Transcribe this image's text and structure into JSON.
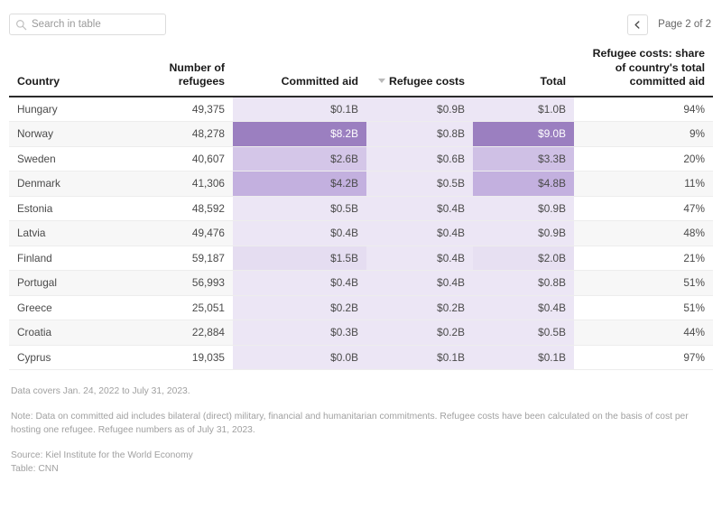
{
  "search": {
    "placeholder": "Search in table",
    "value": "",
    "icon": "search-icon"
  },
  "pagination": {
    "prev_icon": "chevron-left-icon",
    "label": "Page 2 of 2",
    "current_page": 2,
    "total_pages": 2
  },
  "table": {
    "sort": {
      "column": "Refugee costs",
      "direction": "descending",
      "indicator_icon": "triangle-down-icon"
    },
    "columns": [
      {
        "label": "Country",
        "align": "left"
      },
      {
        "label": "Number of refugees",
        "align": "right"
      },
      {
        "label": "Committed aid",
        "align": "right"
      },
      {
        "label": "Refugee costs",
        "align": "right"
      },
      {
        "label": "Total",
        "align": "right"
      },
      {
        "label": "Refugee costs: share of country's total committed aid",
        "align": "right"
      }
    ],
    "rows": [
      {
        "country": "Hungary",
        "refugees": "49,375",
        "committed_aid": "$0.1B",
        "refugee_costs": "$0.9B",
        "total": "$1.0B",
        "share": "94%"
      },
      {
        "country": "Norway",
        "refugees": "48,278",
        "committed_aid": "$8.2B",
        "refugee_costs": "$0.8B",
        "total": "$9.0B",
        "share": "9%"
      },
      {
        "country": "Sweden",
        "refugees": "40,607",
        "committed_aid": "$2.6B",
        "refugee_costs": "$0.6B",
        "total": "$3.3B",
        "share": "20%"
      },
      {
        "country": "Denmark",
        "refugees": "41,306",
        "committed_aid": "$4.2B",
        "refugee_costs": "$0.5B",
        "total": "$4.8B",
        "share": "11%"
      },
      {
        "country": "Estonia",
        "refugees": "48,592",
        "committed_aid": "$0.5B",
        "refugee_costs": "$0.4B",
        "total": "$0.9B",
        "share": "47%"
      },
      {
        "country": "Latvia",
        "refugees": "49,476",
        "committed_aid": "$0.4B",
        "refugee_costs": "$0.4B",
        "total": "$0.9B",
        "share": "48%"
      },
      {
        "country": "Finland",
        "refugees": "59,187",
        "committed_aid": "$1.5B",
        "refugee_costs": "$0.4B",
        "total": "$2.0B",
        "share": "21%"
      },
      {
        "country": "Portugal",
        "refugees": "56,993",
        "committed_aid": "$0.4B",
        "refugee_costs": "$0.4B",
        "total": "$0.8B",
        "share": "51%"
      },
      {
        "country": "Greece",
        "refugees": "25,051",
        "committed_aid": "$0.2B",
        "refugee_costs": "$0.2B",
        "total": "$0.4B",
        "share": "51%"
      },
      {
        "country": "Croatia",
        "refugees": "22,884",
        "committed_aid": "$0.3B",
        "refugee_costs": "$0.2B",
        "total": "$0.5B",
        "share": "44%"
      },
      {
        "country": "Cyprus",
        "refugees": "19,035",
        "committed_aid": "$0.0B",
        "refugee_costs": "$0.1B",
        "total": "$0.1B",
        "share": "97%"
      }
    ],
    "heatmap": {
      "base_color": "#ece6f5",
      "mid_color": "#d4c6e8",
      "strong_color": "#9b7fc0",
      "committed_aid_shades": [
        "#ece6f5",
        "#9b7fc0",
        "#d4c6e8",
        "#c3b0df",
        "#ece6f5",
        "#ece6f5",
        "#e5ddf1",
        "#ece6f5",
        "#ece6f5",
        "#ece6f5",
        "#ece6f5"
      ],
      "refugee_costs_shades": [
        "#ece6f5",
        "#ece6f5",
        "#ece6f5",
        "#ece6f5",
        "#ece6f5",
        "#ece6f5",
        "#ece6f5",
        "#ece6f5",
        "#ece6f5",
        "#ece6f5",
        "#ece6f5"
      ],
      "total_shades": [
        "#ece6f5",
        "#9b7fc0",
        "#cfc0e5",
        "#c3b0df",
        "#ece6f5",
        "#ece6f5",
        "#e7e0f2",
        "#ece6f5",
        "#ece6f5",
        "#ece6f5",
        "#ece6f5"
      ],
      "dark_text_cells": [
        "aid-1",
        "total-1"
      ]
    }
  },
  "footnotes": {
    "coverage": "Data covers Jan. 24, 2022 to July 31, 2023.",
    "note": "Note: Data on committed aid includes bilateral (direct) military, financial and humanitarian commitments. Refugee costs have been calculated on the basis of cost per hosting one refugee. Refugee numbers as of July 31, 2023.",
    "source": "Source: Kiel Institute for the World Economy",
    "credit": "Table: CNN"
  }
}
